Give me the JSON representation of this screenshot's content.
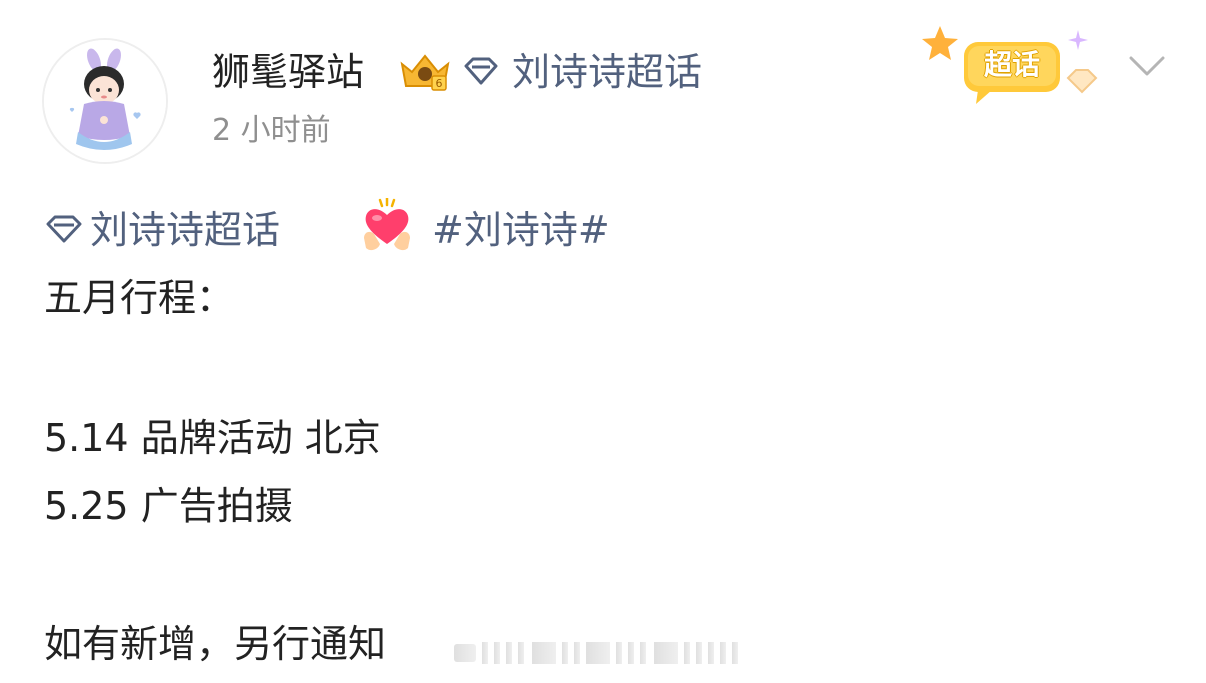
{
  "post": {
    "author": "狮髦驿站",
    "topic": "刘诗诗超话",
    "time": "2 小时前",
    "supertopic_badge": "超话"
  },
  "content": {
    "topic_link": "刘诗诗超话",
    "hashtag": "#刘诗诗#",
    "heading": "五月行程：",
    "schedule": [
      "5.14 品牌活动 北京",
      "5.25 广告拍摄"
    ],
    "footer": "如有新增，另行通知"
  },
  "icons": {
    "avatar": "avatar-illustration",
    "vip": "vip-crown-badge-icon",
    "topic": "diamond-icon",
    "heart": "heart-hands-emoji",
    "menu": "chevron-down-icon"
  },
  "colors": {
    "link": "#52617e",
    "text": "#222222",
    "meta": "#8f8f8f",
    "badge": "#ffc400"
  }
}
